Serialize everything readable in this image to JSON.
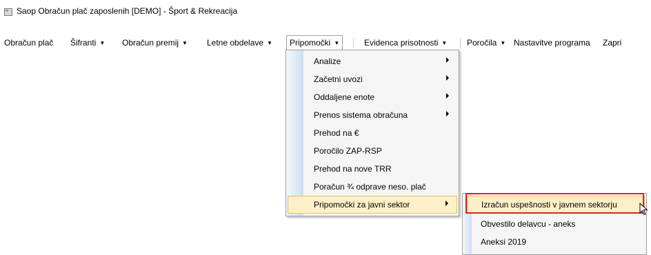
{
  "window": {
    "title": "Saop Obračun plač zaposlenih  [DEMO] - Šport & Rekreacija"
  },
  "menubar": {
    "items": [
      {
        "label": "Obračun plač",
        "has_arrow": false
      },
      {
        "label": "Šifranti",
        "has_arrow": true
      },
      {
        "label": "Obračun premij",
        "has_arrow": true
      },
      {
        "label": "Letne obdelave",
        "has_arrow": true
      },
      {
        "label": "Pripomočki",
        "has_arrow": true
      },
      {
        "label": "Evidenca prisotnosti",
        "has_arrow": true
      },
      {
        "label": "Poročila",
        "has_arrow": true
      },
      {
        "label": "Nastavitve programa",
        "has_arrow": false
      },
      {
        "label": "Zapri",
        "has_arrow": false
      }
    ],
    "arrow_glyph": "▼"
  },
  "dropdown": {
    "items": [
      {
        "label": "Analize",
        "submenu": true
      },
      {
        "label": "Začetni uvozi",
        "submenu": true
      },
      {
        "label": "Oddaljene enote",
        "submenu": true
      },
      {
        "label": "Prenos sistema obračuna",
        "submenu": true
      },
      {
        "label": "Prehod na €",
        "submenu": false
      },
      {
        "label": "Poročilo ZAP-RSP",
        "submenu": false
      },
      {
        "label": "Prehod na nove TRR",
        "submenu": false
      },
      {
        "label": "Poračun ¾ odprave neso. plač",
        "submenu": false
      },
      {
        "label": "Pripomočki za javni sektor",
        "submenu": true,
        "highlighted": true
      }
    ]
  },
  "submenu": {
    "items": [
      {
        "label": "Izračun uspešnosti v javnem sektorju",
        "highlighted": true
      },
      {
        "label": "Obvestilo delavcu - aneks"
      },
      {
        "label": "Aneksi 2019"
      }
    ]
  },
  "colors": {
    "highlight_fill": "#fdf0c8",
    "highlight_border": "#e2bd68",
    "annotation_red": "#e0201e"
  }
}
